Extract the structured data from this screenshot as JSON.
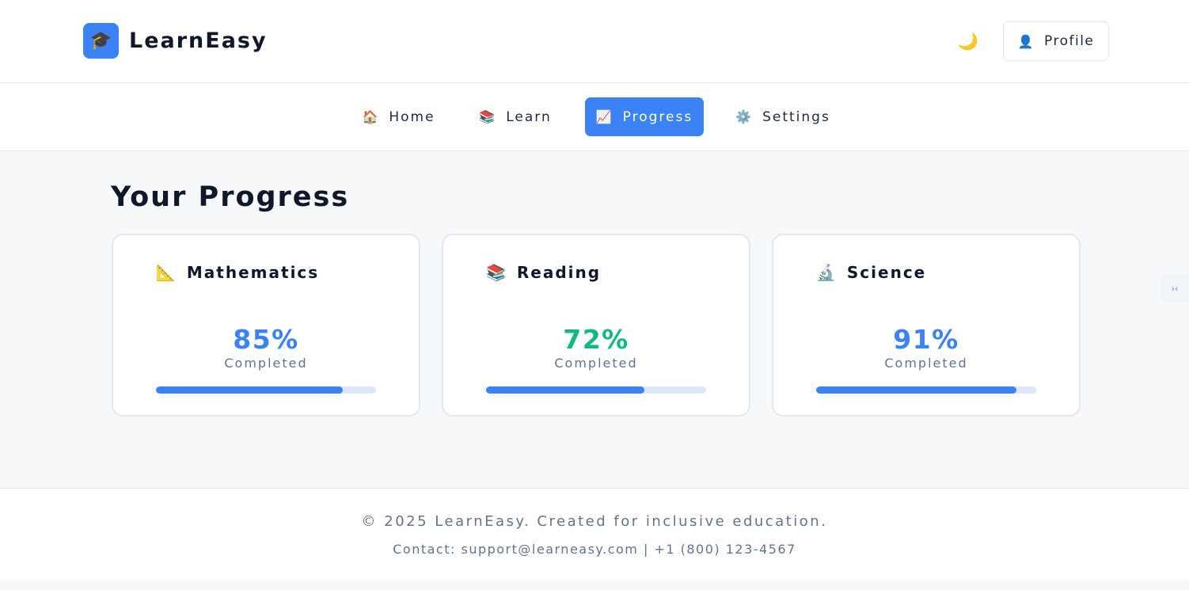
{
  "header": {
    "brand": "LearnEasy",
    "logo_icon": "🎓",
    "theme_icon": "🌙",
    "profile_icon": "👤",
    "profile_label": "Profile"
  },
  "nav": {
    "items": [
      {
        "icon": "🏠",
        "label": "Home"
      },
      {
        "icon": "📚",
        "label": "Learn"
      },
      {
        "icon": "📈",
        "label": "Progress"
      },
      {
        "icon": "⚙️",
        "label": "Settings"
      }
    ],
    "active": "Progress"
  },
  "main": {
    "title": "Your Progress",
    "cards": [
      {
        "icon": "📐",
        "subject": "Mathematics",
        "percent": "85%",
        "progress": 85,
        "status": "Completed",
        "color": "#3b82f6"
      },
      {
        "icon": "📚",
        "subject": "Reading",
        "percent": "72%",
        "progress": 72,
        "status": "Completed",
        "color": "#10b981"
      },
      {
        "icon": "🔬",
        "subject": "Science",
        "percent": "91%",
        "progress": 91,
        "status": "Completed",
        "color": "#3b82f6"
      }
    ]
  },
  "side_widget": {
    "icon": "›‹"
  },
  "footer": {
    "copyright": "© 2025 LearnEasy. Created for inclusive education.",
    "contact": "Contact: support@learneasy.com | +1 (800) 123-4567"
  },
  "colors": {
    "accent": "#3b82f6",
    "success": "#10b981",
    "bar_track": "#dbe7fb"
  }
}
